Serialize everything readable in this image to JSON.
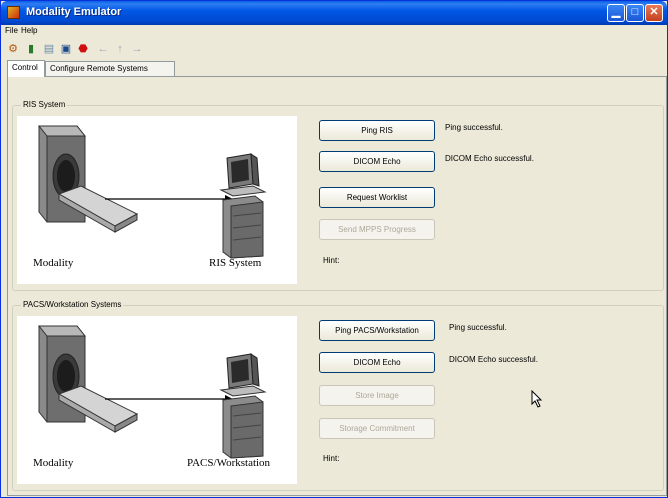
{
  "window": {
    "title": "Modality Emulator"
  },
  "menu": {
    "items": [
      "File",
      "Help"
    ]
  },
  "toolbar": {
    "icons": [
      "configure-icon",
      "book-icon",
      "notes-icon",
      "monitor-icon",
      "stop-icon",
      "back-arrow-icon",
      "up-arrow-icon",
      "forward-arrow-icon"
    ]
  },
  "tabs": [
    {
      "label": "Control",
      "active": true
    },
    {
      "label": "Configure Remote Systems",
      "active": false
    }
  ],
  "ris": {
    "group_title": "RIS System",
    "left_caption": "Modality",
    "right_caption": "RIS System",
    "buttons": [
      {
        "label": "Ping RIS",
        "enabled": true,
        "status": "Ping successful."
      },
      {
        "label": "DICOM Echo",
        "enabled": true,
        "status": "DICOM Echo successful."
      },
      {
        "label": "Request Worklist",
        "enabled": true,
        "status": ""
      },
      {
        "label": "Send MPPS Progress",
        "enabled": false,
        "status": ""
      }
    ],
    "hint_label": "Hint:"
  },
  "pacs": {
    "group_title": "PACS/Workstation Systems",
    "left_caption": "Modality",
    "right_caption": "PACS/Workstation",
    "buttons": [
      {
        "label": "Ping PACS/Workstation",
        "enabled": true,
        "status": "Ping successful."
      },
      {
        "label": "DICOM Echo",
        "enabled": true,
        "status": "DICOM Echo successful."
      },
      {
        "label": "Store Image",
        "enabled": false,
        "status": ""
      },
      {
        "label": "Storage Commitment",
        "enabled": false,
        "status": ""
      }
    ],
    "hint_label": "Hint:"
  }
}
